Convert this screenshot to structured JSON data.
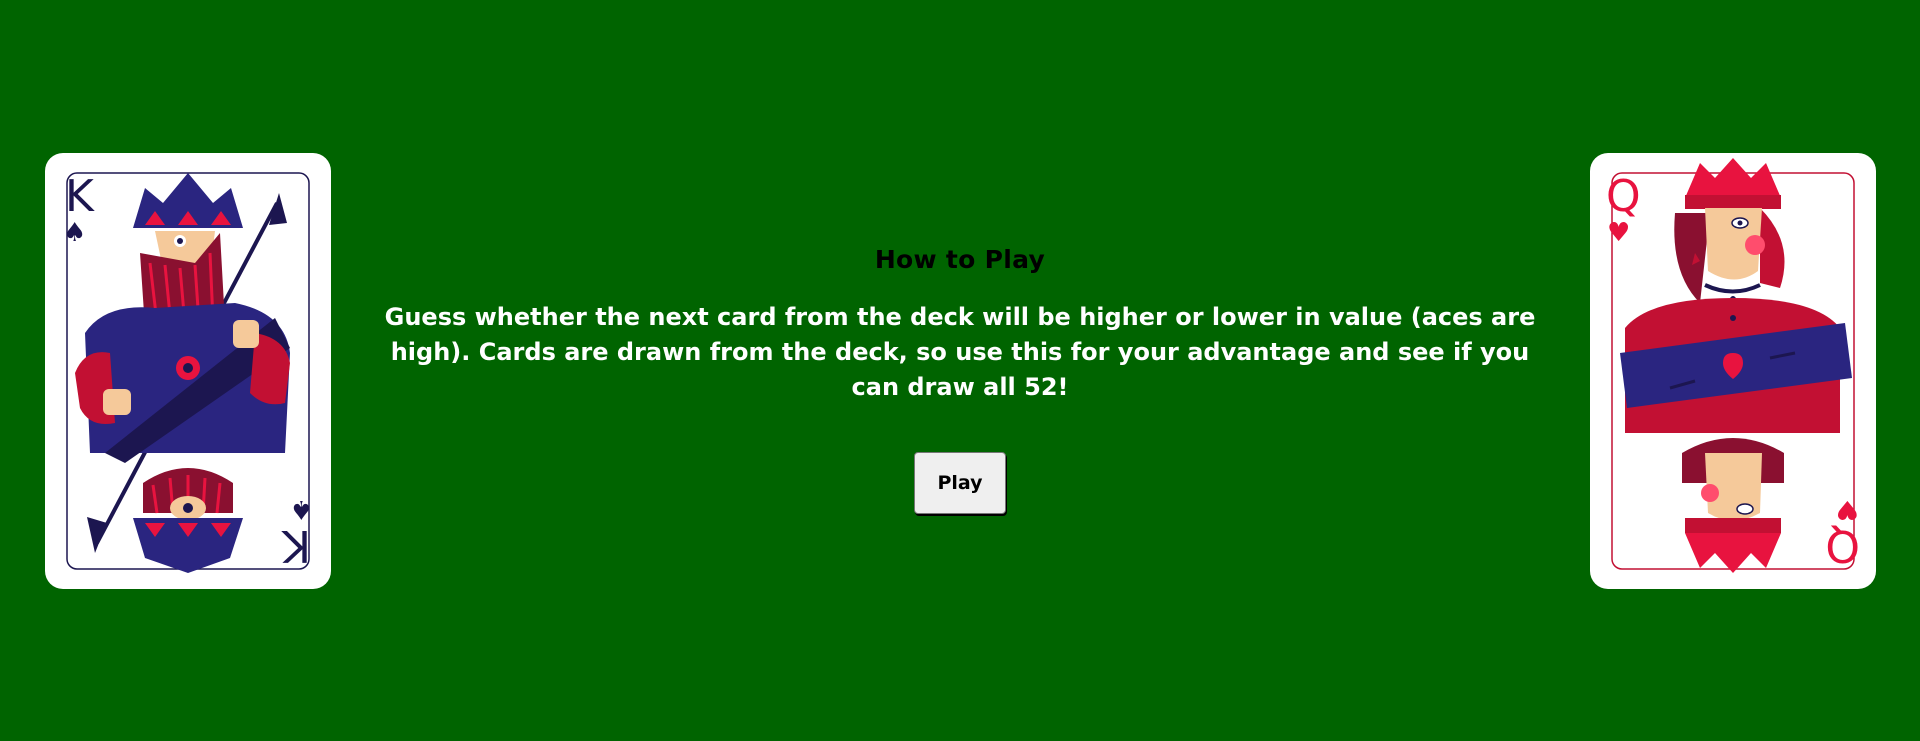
{
  "left_card": {
    "rank": "K",
    "suit": "spades",
    "suit_glyph": "♠",
    "ink": "#1c1650",
    "accent": "#e8133f",
    "robe": "#2a2580"
  },
  "right_card": {
    "rank": "Q",
    "suit": "hearts",
    "suit_glyph": "♥",
    "ink": "#e8133f",
    "accent": "#c21033",
    "robe": "#2a2580"
  },
  "instructions": {
    "title": "How to Play",
    "text": "Guess whether the next card from the deck will be higher or lower in value (aces are high). Cards are drawn from the deck, so use this for your advantage and see if you can draw all 52!"
  },
  "controls": {
    "play_label": "Play"
  },
  "colors": {
    "table_green": "#006400"
  }
}
